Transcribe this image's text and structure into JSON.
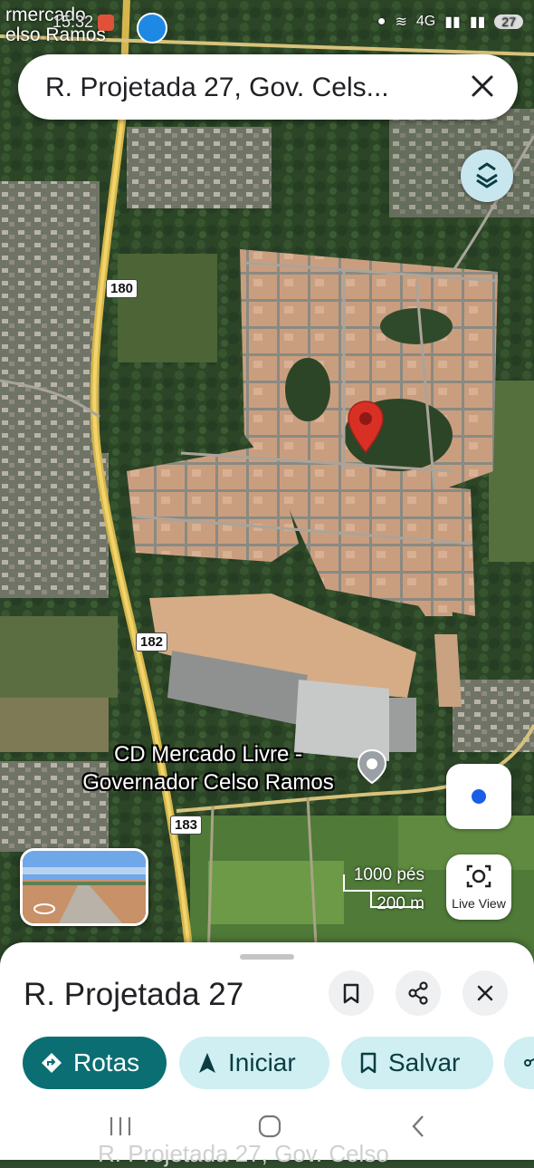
{
  "status_bar": {
    "notification_text_line1": "rmercado",
    "notification_text_line2": "elso Ramos",
    "time": "15:32",
    "network_label": "4G",
    "battery": "27"
  },
  "search": {
    "query": "R. Projetada 27, Gov. Cels..."
  },
  "map": {
    "poi_label_line1": "CD Mercado Livre -",
    "poi_label_line2": "Governador Celso Ramos",
    "highway_shields": [
      "180",
      "182",
      "183"
    ],
    "scale_imperial": "1000 pés",
    "scale_metric": "200 m"
  },
  "controls": {
    "live_view_label": "Live View"
  },
  "place_sheet": {
    "title": "R. Projetada 27",
    "actions": {
      "directions_label": "Rotas",
      "start_label": "Iniciar",
      "save_label": "Salvar"
    }
  },
  "background_text": "R. Projetada 27, Gov. Celso",
  "colors": {
    "primary_teal": "#0b6e73",
    "chip_light": "#cfeff2",
    "pin_red": "#d93025",
    "location_blue": "#1a5ee6"
  }
}
